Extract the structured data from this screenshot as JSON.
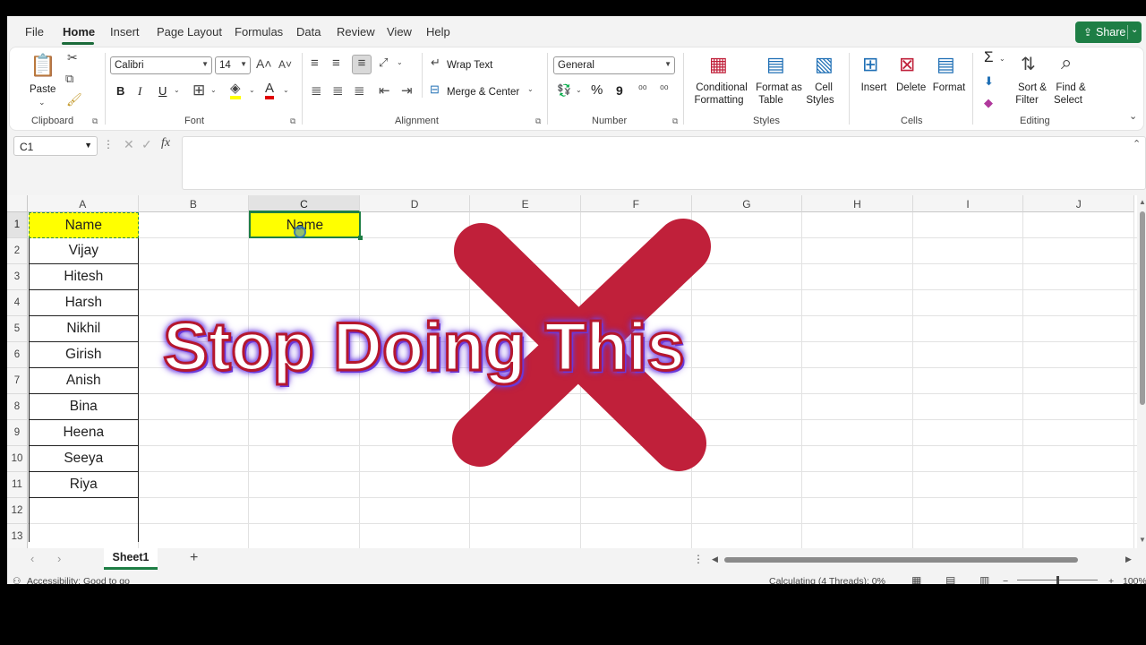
{
  "menu": {
    "items": [
      "File",
      "Home",
      "Insert",
      "Page Layout",
      "Formulas",
      "Data",
      "Review",
      "View",
      "Help"
    ],
    "share": "Share"
  },
  "ribbon": {
    "clipboard": {
      "label": "Clipboard",
      "paste": "Paste"
    },
    "font": {
      "label": "Font",
      "name": "Calibri",
      "size": "14",
      "bold": "B",
      "italic": "I",
      "underline": "U"
    },
    "alignment": {
      "label": "Alignment",
      "wrap": "Wrap Text",
      "merge": "Merge & Center"
    },
    "number": {
      "label": "Number",
      "format": "General",
      "percent": "%",
      "comma": "9"
    },
    "styles": {
      "label": "Styles",
      "cond1": "Conditional",
      "cond2": "Formatting",
      "fmt1": "Format as",
      "fmt2": "Table",
      "cell1": "Cell",
      "cell2": "Styles"
    },
    "cells": {
      "label": "Cells",
      "insert": "Insert",
      "delete": "Delete",
      "format": "Format"
    },
    "editing": {
      "label": "Editing",
      "sort1": "Sort &",
      "sort2": "Filter",
      "find1": "Find &",
      "find2": "Select",
      "sigma": "Σ"
    }
  },
  "formula_bar": {
    "name_box": "C1",
    "fx": "fx",
    "content": ""
  },
  "grid": {
    "columns": [
      "A",
      "B",
      "C",
      "D",
      "E",
      "F",
      "G",
      "H",
      "I",
      "J"
    ],
    "rows": [
      "1",
      "2",
      "3",
      "4",
      "5",
      "6",
      "7",
      "8",
      "9",
      "10",
      "11",
      "12",
      "13"
    ],
    "column_a": [
      "Name",
      "Vijay",
      "Hitesh",
      "Harsh",
      "Nikhil",
      "Girish",
      "Anish",
      "Bina",
      "Heena",
      "Seeya",
      "Riya"
    ],
    "c1": "Name",
    "selected_cell": "C1",
    "highlight_color": "#ffff00"
  },
  "overlay": {
    "text": "Stop Doing This",
    "x_color": "#c0203a"
  },
  "sheets": {
    "tabs": [
      "Sheet1"
    ],
    "add": "+"
  },
  "status": {
    "left": "Accessibility: Good to go",
    "calc": "Calculating (4 Threads): 0%",
    "zoom": "100%"
  },
  "colors": {
    "accent": "#1e7e45"
  }
}
